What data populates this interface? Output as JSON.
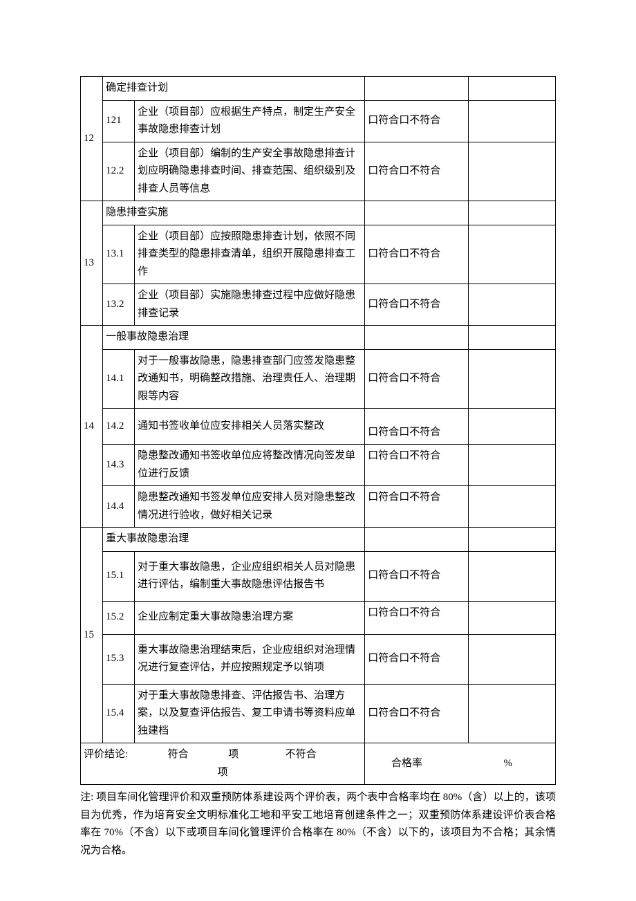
{
  "compliance_text": "口符合口不符合",
  "sections": {
    "s12": {
      "group": "12",
      "header": "确定排查计划",
      "rows": [
        {
          "sub": "121",
          "desc": "企业（项目部）应根据生产特点，制定生产安全事故隐患排查计划"
        },
        {
          "sub": "12.2",
          "desc": "企业（项目部）编制的生产安全事故隐患排查计划应明确隐患排查时间、排查范围、组织级别及排查人员等信息"
        }
      ]
    },
    "s13": {
      "group": "13",
      "header": "隐患排查实施",
      "rows": [
        {
          "sub": "13.1",
          "desc": "企业（项目部）应按照隐患排查计划，依照不同排查类型的隐患排查清单，组织开展隐患排查工作"
        },
        {
          "sub": "13.2",
          "desc": "企业（项目部）实施隐患排查过程中应做好隐患排查记录"
        }
      ]
    },
    "s14": {
      "group": "14",
      "header": "一般事故隐患治理",
      "rows": [
        {
          "sub": "14.1",
          "desc": "对于一般事故隐患，隐患排查部门应签发隐患整改通知书，明确整改措施、治理责任人、治理期限等内容"
        },
        {
          "sub": "14.2",
          "desc": "通知书签收单位应安排相关人员落实整改"
        },
        {
          "sub": "14.3",
          "desc": "隐患整改通知书签收单位应将整改情况向签发单位进行反馈"
        },
        {
          "sub": "14.4",
          "desc": "隐患整改通知书签发单位应安排人员对隐患整改情况进行验收，做好相关记录"
        }
      ]
    },
    "s15": {
      "group": "15",
      "header": "重大事故隐患治理",
      "rows": [
        {
          "sub": "15.1",
          "desc": "对于重大事故隐患，企业应组织相关人员对隐患进行评估，编制重大事故隐患评估报告书"
        },
        {
          "sub": "15.2",
          "desc": "企业应制定重大事故隐患治理方案"
        },
        {
          "sub": "15.3",
          "desc": "重大事故隐患治理结束后，企业应组织对治理情况进行复查评估，并应按照规定予以销项"
        },
        {
          "sub": "15.4",
          "desc": "对于重大事故隐患排查、评估报告书、治理方案，以及复查评估报告、复工申请书等资料应单独建档"
        }
      ]
    }
  },
  "s14_row2_compliance_valign": "bottom",
  "conclusion": {
    "label_prefix": "评价结论:",
    "compliant_label": "符合",
    "item_label": "项",
    "noncompliant_label": "不符合",
    "rate_label": "合格率",
    "percent": "%"
  },
  "footnote": "注: 项目车间化管理评价和双重预防体系建设两个评价表，两个表中合格率均在 80%（含）以上的，该项目为优秀，作为培育安全文明标准化工地和平安工地培育创建条件之一；双重预防体系建设评价表合格率在 70%（不含）以下或项目车间化管理评价合格率在 80%（不含）以下的，该项目为不合格；其余情况为合格。"
}
